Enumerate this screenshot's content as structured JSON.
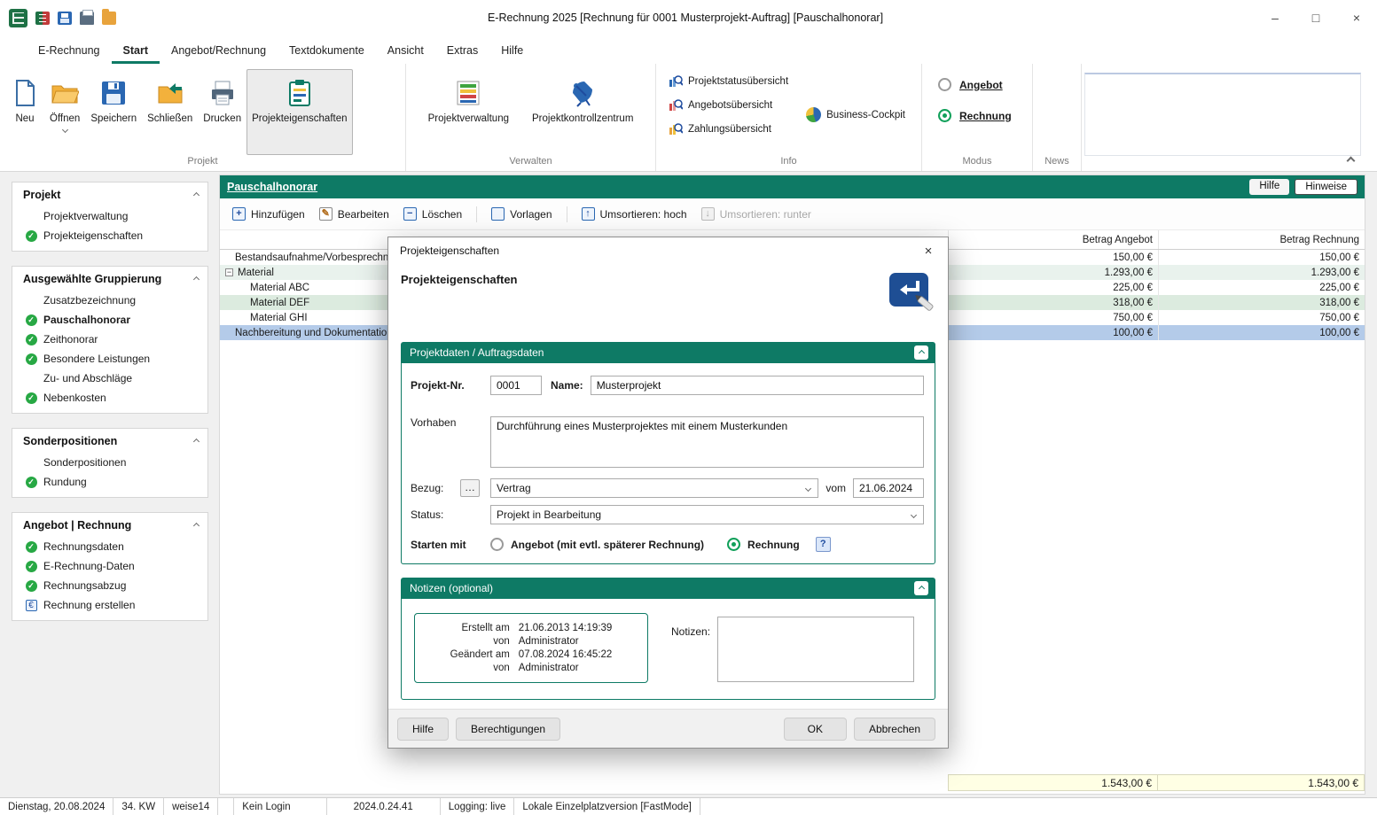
{
  "icons": {
    "minimize": "–",
    "maximize": "□",
    "close": "×",
    "minus": "−",
    "plus": "+",
    "pencil": "✎",
    "arrow_up": "↑",
    "arrow_down": "↓",
    "check": "✓",
    "euro": "€"
  },
  "titlebar": {
    "title": "E-Rechnung 2025  [Rechnung für 0001 Musterprojekt-Auftrag] [Pauschalhonorar]"
  },
  "menubar": {
    "tabs": [
      "E-Rechnung",
      "Start",
      "Angebot/Rechnung",
      "Textdokumente",
      "Ansicht",
      "Extras",
      "Hilfe"
    ]
  },
  "ribbon": {
    "projekt": {
      "label": "Projekt",
      "neu": "Neu",
      "oeffnen": "Öffnen",
      "speichern": "Speichern",
      "schliessen": "Schließen",
      "drucken": "Drucken",
      "projekteigenschaften": "Projekteigenschaften"
    },
    "verwalten": {
      "label": "Verwalten",
      "projektverwaltung": "Projektverwaltung",
      "projektkontrollzentrum": "Projektkontrollzentrum"
    },
    "info": {
      "label": "Info",
      "projektstatus": "Projektstatusübersicht",
      "angebots": "Angebotsübersicht",
      "zahlungs": "Zahlungsübersicht",
      "cockpit": "Business-Cockpit"
    },
    "modus": {
      "label": "Modus",
      "angebot": "Angebot",
      "rechnung": "Rechnung"
    },
    "news": {
      "label": "News"
    }
  },
  "sidebar": {
    "panels": [
      {
        "title": "Projekt",
        "items": [
          {
            "label": "Projektverwaltung",
            "check": false
          },
          {
            "label": "Projekteigenschaften",
            "check": true
          }
        ]
      },
      {
        "title": "Ausgewählte Gruppierung",
        "items": [
          {
            "label": "Zusatzbezeichnung",
            "check": false
          },
          {
            "label": "Pauschalhonorar",
            "check": true,
            "bold": true
          },
          {
            "label": "Zeithonorar",
            "check": true
          },
          {
            "label": "Besondere Leistungen",
            "check": true
          },
          {
            "label": "Zu- und Abschläge",
            "check": false
          },
          {
            "label": "Nebenkosten",
            "check": true
          }
        ]
      },
      {
        "title": "Sonderpositionen",
        "items": [
          {
            "label": "Sonderpositionen",
            "check": false
          },
          {
            "label": "Rundung",
            "check": true
          }
        ]
      },
      {
        "title": "Angebot | Rechnung",
        "items": [
          {
            "label": "Rechnungsdaten",
            "check": true
          },
          {
            "label": "E-Rechnung-Daten",
            "check": true
          },
          {
            "label": "Rechnungsabzug",
            "check": true
          },
          {
            "label": "Rechnung erstellen",
            "check": false,
            "euro": true
          }
        ]
      }
    ]
  },
  "content": {
    "title": "Pauschalhonorar",
    "hilfe_button": "Hilfe",
    "hinweise_button": "Hinweise",
    "toolbar": {
      "hinzufuegen": "Hinzufügen",
      "bearbeiten": "Bearbeiten",
      "loeschen": "Löschen",
      "vorlagen": "Vorlagen",
      "hoch": "Umsortieren: hoch",
      "runter": "Umsortieren: runter"
    },
    "table": {
      "col_angebot": "Betrag Angebot",
      "col_rechnung": "Betrag Rechnung",
      "rows": [
        {
          "name": "Bestandsaufnahme/Vorbesprechnung",
          "angebot": "150,00 €",
          "rechnung": "150,00 €"
        },
        {
          "name": "Material",
          "angebot": "1.293,00 €",
          "rechnung": "1.293,00 €"
        },
        {
          "name": "Material ABC",
          "angebot": "225,00 €",
          "rechnung": "225,00 €"
        },
        {
          "name": "Material DEF",
          "angebot": "318,00 €",
          "rechnung": "318,00 €"
        },
        {
          "name": "Material GHI",
          "angebot": "750,00 €",
          "rechnung": "750,00 €"
        },
        {
          "name": "Nachbereitung und Dokumentation",
          "angebot": "100,00 €",
          "rechnung": "100,00 €"
        }
      ],
      "total_angebot": "1.543,00 €",
      "total_rechnung": "1.543,00 €"
    }
  },
  "dialog": {
    "window_title": "Projekteigenschaften",
    "heading": "Projekteigenschaften",
    "section1": {
      "title": "Projektdaten / Auftragsdaten",
      "projekt_nr_label": "Projekt-Nr.",
      "projekt_nr_value": "0001",
      "name_label": "Name:",
      "name_value": "Musterprojekt",
      "vorhaben_label": "Vorhaben",
      "vorhaben_value": "Durchführung eines Musterprojektes mit einem Musterkunden",
      "bezug_label": "Bezug:",
      "bezug_more": "…",
      "bezug_value": "Vertrag",
      "vom_label": "vom",
      "vom_value": "21.06.2024",
      "status_label": "Status:",
      "status_value": "Projekt in Bearbeitung",
      "starten_label": "Starten mit",
      "option_angebot": "Angebot (mit evtl. späterer Rechnung)",
      "option_rechnung": "Rechnung",
      "help": "?"
    },
    "section2": {
      "title": "Notizen (optional)",
      "erstellt_label": "Erstellt am",
      "erstellt_value": "21.06.2013 14:19:39",
      "von1_label": "von",
      "von1_value": "Administrator",
      "geaendert_label": "Geändert am",
      "geaendert_value": "07.08.2024 16:45:22",
      "von2_label": "von",
      "von2_value": "Administrator",
      "notizen_label": "Notizen:"
    },
    "buttons": {
      "hilfe": "Hilfe",
      "berechtigungen": "Berechtigungen",
      "ok": "OK",
      "abbrechen": "Abbrechen"
    }
  },
  "statusbar": {
    "items": [
      "Dienstag, 20.08.2024",
      "34. KW",
      "weise14",
      "Kein Login",
      "2024.0.24.41",
      "Logging: live",
      "Lokale Einzelplatzversion [FastMode]"
    ]
  }
}
